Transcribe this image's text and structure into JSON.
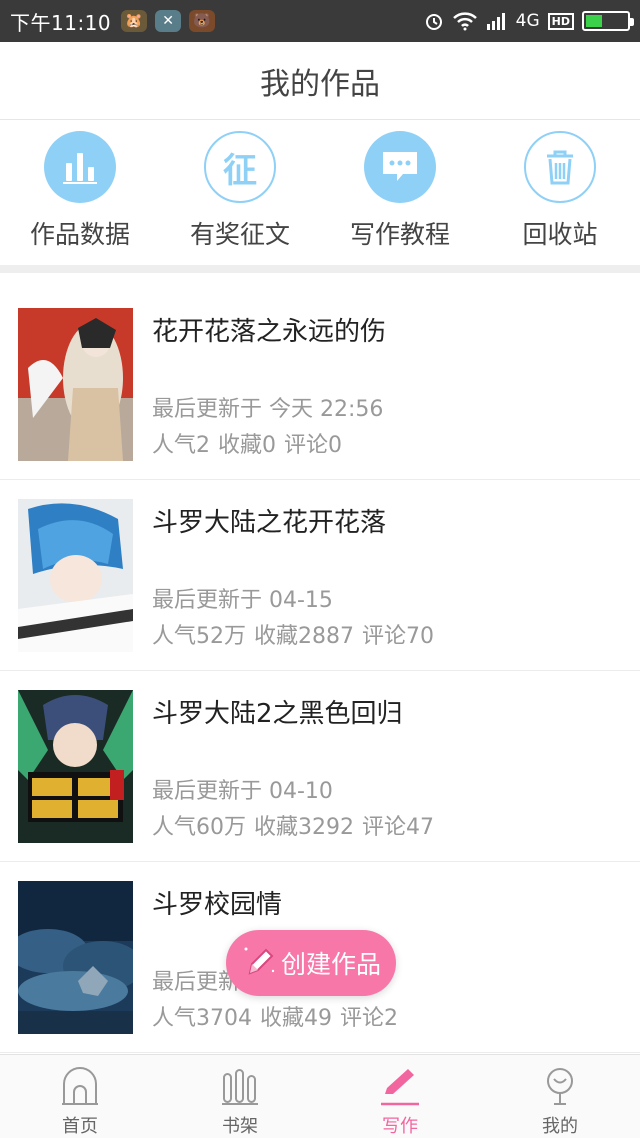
{
  "status_bar": {
    "time": "下午11:10",
    "network": "4G",
    "hd": "HD"
  },
  "header": {
    "title": "我的作品"
  },
  "quick_actions": [
    {
      "label": "作品数据",
      "icon": "bar-chart-icon"
    },
    {
      "label": "有奖征文",
      "icon": "contest-icon",
      "glyph": "征"
    },
    {
      "label": "写作教程",
      "icon": "chat-bubble-icon"
    },
    {
      "label": "回收站",
      "icon": "trash-icon"
    }
  ],
  "works": [
    {
      "title": "花开花落之永远的伤",
      "updated": "最后更新于 今天 22:56",
      "popularity": "人气2",
      "favorites": "收藏0",
      "comments": "评论0"
    },
    {
      "title": "斗罗大陆之花开花落",
      "updated": "最后更新于 04-15",
      "popularity": "人气52万",
      "favorites": "收藏2887",
      "comments": "评论70"
    },
    {
      "title": "斗罗大陆2之黑色回归",
      "updated": "最后更新于 04-10",
      "popularity": "人气60万",
      "favorites": "收藏3292",
      "comments": "评论47"
    },
    {
      "title": "斗罗校园情",
      "updated": "最后更新",
      "popularity": "人气3704",
      "favorites": "收藏49",
      "comments": "评论2"
    }
  ],
  "fab": {
    "label": "创建作品"
  },
  "bottom_nav": [
    {
      "label": "首页",
      "icon": "home-icon"
    },
    {
      "label": "书架",
      "icon": "bookshelf-icon"
    },
    {
      "label": "写作",
      "icon": "pen-icon",
      "active": true
    },
    {
      "label": "我的",
      "icon": "profile-icon"
    }
  ],
  "colors": {
    "accent_pink": "#f266a0",
    "icon_blue": "#8fd0f7",
    "status_bar": "#3a3a3a"
  }
}
